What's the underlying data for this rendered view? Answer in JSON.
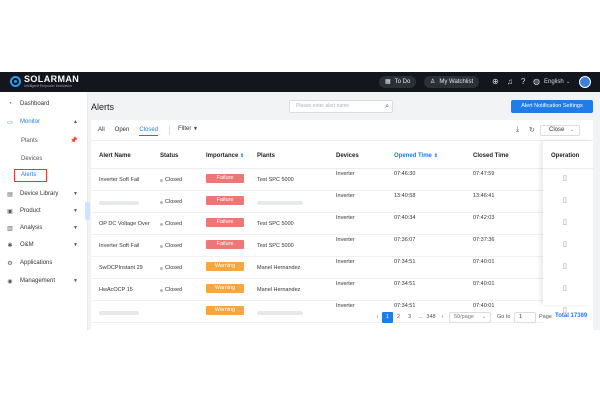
{
  "header": {
    "logo_name": "SOLARMAN",
    "logo_tagline": "Intelligent Empower Innovation",
    "todo_label": "To Do",
    "watchlist_label": "My Watchlist",
    "language": "English",
    "icons": [
      "plus-circle-icon",
      "bell-icon",
      "help-icon",
      "globe-icon",
      "user-avatar"
    ]
  },
  "sidebar": {
    "items": [
      {
        "label": "Dashboard",
        "icon": "dashboard-icon"
      },
      {
        "label": "Monitor",
        "icon": "monitor-icon"
      },
      {
        "label": "Device Library",
        "icon": "device-library-icon"
      },
      {
        "label": "Product",
        "icon": "product-icon"
      },
      {
        "label": "Analysis",
        "icon": "analysis-icon"
      },
      {
        "label": "O&M",
        "icon": "om-icon"
      },
      {
        "label": "Applications",
        "icon": "applications-icon"
      },
      {
        "label": "Management",
        "icon": "management-icon"
      }
    ],
    "monitor_sub": [
      "Plants",
      "Devices",
      "Alerts"
    ],
    "accent": "#1f7ce8",
    "highlight_border": "#e53935"
  },
  "page": {
    "title": "Alerts",
    "search_placeholder": "Please enter alert name",
    "notification_button": "Alert Notification Settings"
  },
  "toolbar": {
    "tabs": [
      "All",
      "Open",
      "Closed"
    ],
    "active_tab": "Closed",
    "filter_label": "Filter",
    "close_label": "Close"
  },
  "table": {
    "columns": [
      "Alert Name",
      "Status",
      "Importance",
      "Plants",
      "Devices",
      "Opened Time",
      "Closed Time"
    ],
    "operation_column": "Operation",
    "rows": [
      {
        "name": "Inverter Soft Fail",
        "status": "Closed",
        "importance": "Failure",
        "plant": "Test SPC 5000",
        "device": "Inverter",
        "opened": "07:46:30",
        "closed": "07:47:59"
      },
      {
        "name": "",
        "status": "Closed",
        "importance": "Failure",
        "plant": "",
        "device": "Inverter",
        "opened": "13:40:58",
        "closed": "13:46:41"
      },
      {
        "name": "OP DC Voltage Over",
        "status": "Closed",
        "importance": "Failure",
        "plant": "Test SPC 5000",
        "device": "Inverter",
        "opened": "07:40:34",
        "closed": "07:42:03"
      },
      {
        "name": "Inverter Soft Fail",
        "status": "Closed",
        "importance": "Failure",
        "plant": "Test SPC 5000",
        "device": "Inverter",
        "opened": "07:36:07",
        "closed": "07:37:36"
      },
      {
        "name": "SwOCPInstant 29",
        "status": "Closed",
        "importance": "Warning",
        "plant": "Manel Hernandez",
        "device": "Inverter",
        "opened": "07:34:51",
        "closed": "07:40:01"
      },
      {
        "name": "HwAcOCP 15",
        "status": "Closed",
        "importance": "Warning",
        "plant": "Manel Hernandez",
        "device": "Inverter",
        "opened": "07:34:51",
        "closed": "07:40:01"
      },
      {
        "name": "",
        "status": "",
        "importance": "Warning",
        "plant": "",
        "device": "Inverter",
        "opened": "07:34:51",
        "closed": "07:40:01"
      }
    ],
    "colors": {
      "failure": "#f07676",
      "warning": "#f6a83e"
    }
  },
  "pagination": {
    "pages": [
      "1",
      "2",
      "3",
      "...",
      "348"
    ],
    "current_page": "1",
    "per_page": "50/page",
    "goto_label": "Go to",
    "goto_value": "1",
    "page_suffix": "Page",
    "total": "Total 17369"
  }
}
